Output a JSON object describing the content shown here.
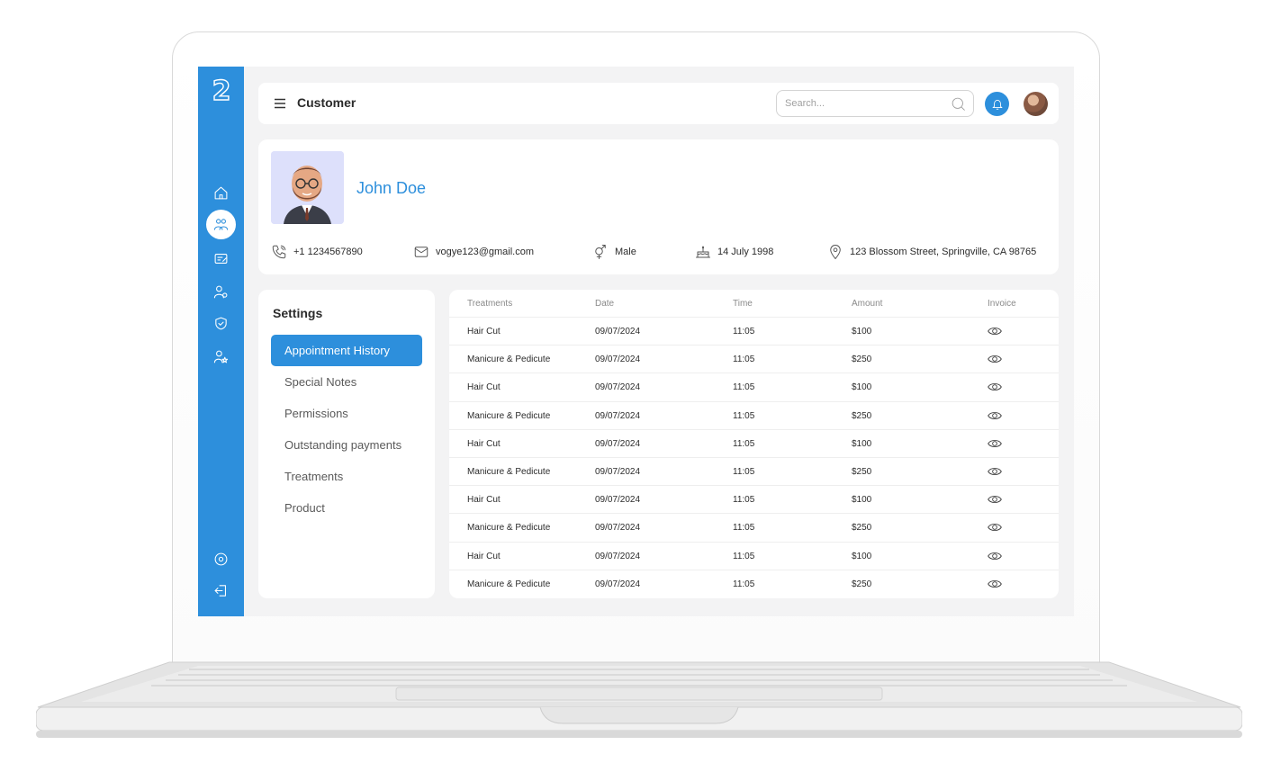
{
  "header": {
    "title": "Customer",
    "search_placeholder": "Search..."
  },
  "sidebar": {
    "logo": "2",
    "items": [
      {
        "name": "home-icon"
      },
      {
        "name": "customers-icon",
        "active": true
      },
      {
        "name": "tickets-icon"
      },
      {
        "name": "staff-icon"
      },
      {
        "name": "shield-icon"
      },
      {
        "name": "user-star-icon"
      },
      {
        "name": "settings-icon"
      },
      {
        "name": "logout-icon"
      }
    ]
  },
  "profile": {
    "name": "John Doe",
    "phone": "+1 1234567890",
    "email": "vogye123@gmail.com",
    "gender": "Male",
    "birthday": "14 July 1998",
    "address": "123 Blossom Street, Springville, CA 98765"
  },
  "settings": {
    "title": "Settings",
    "items": [
      {
        "label": "Appointment  History",
        "active": true
      },
      {
        "label": "Special Notes"
      },
      {
        "label": "Permissions"
      },
      {
        "label": "Outstanding payments"
      },
      {
        "label": "Treatments"
      },
      {
        "label": "Product"
      }
    ]
  },
  "table": {
    "columns": [
      "Treatments",
      "Date",
      "Time",
      "Amount",
      "Invoice"
    ],
    "rows": [
      [
        "Hair Cut",
        "09/07/2024",
        "11:05",
        "$100"
      ],
      [
        "Manicure & Pedicute",
        "09/07/2024",
        "11:05",
        "$250"
      ],
      [
        "Hair Cut",
        "09/07/2024",
        "11:05",
        "$100"
      ],
      [
        "Manicure & Pedicute",
        "09/07/2024",
        "11:05",
        "$250"
      ],
      [
        "Hair Cut",
        "09/07/2024",
        "11:05",
        "$100"
      ],
      [
        "Manicure & Pedicute",
        "09/07/2024",
        "11:05",
        "$250"
      ],
      [
        "Hair Cut",
        "09/07/2024",
        "11:05",
        "$100"
      ],
      [
        "Manicure & Pedicute",
        "09/07/2024",
        "11:05",
        "$250"
      ],
      [
        "Hair Cut",
        "09/07/2024",
        "11:05",
        "$100"
      ],
      [
        "Manicure & Pedicute",
        "09/07/2024",
        "11:05",
        "$250"
      ]
    ]
  },
  "colors": {
    "accent": "#2d8fdc",
    "background": "#f3f3f4",
    "card": "#ffffff"
  }
}
